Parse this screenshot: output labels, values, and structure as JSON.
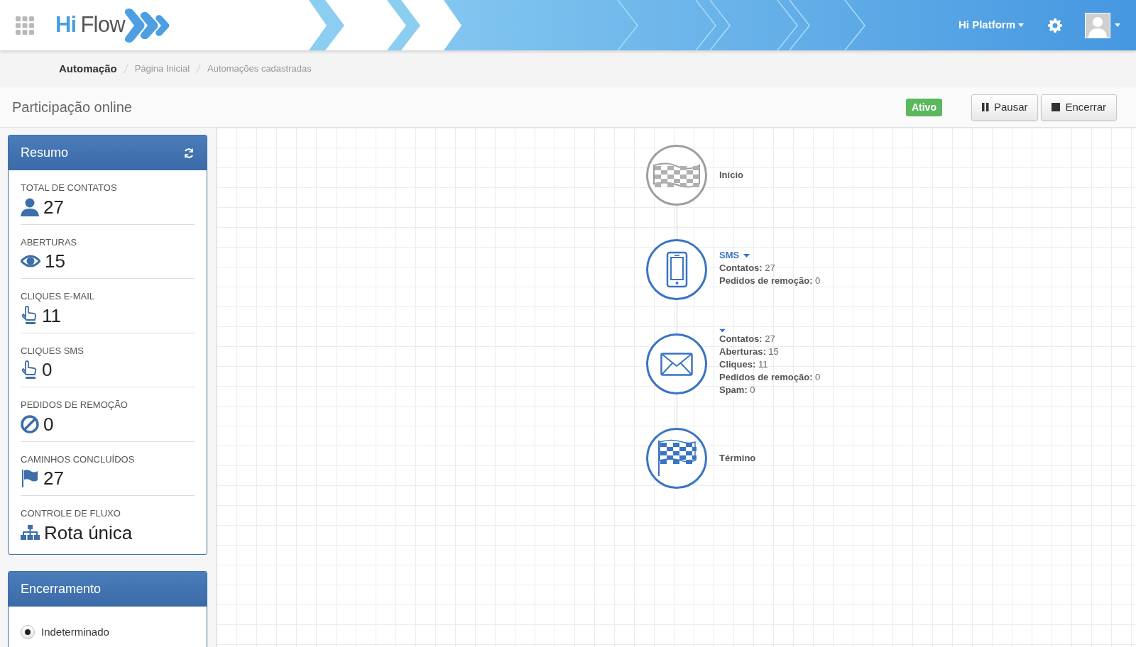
{
  "header": {
    "logo": {
      "first": "Hi",
      "second": "Flow"
    },
    "platform_menu": "Hi Platform"
  },
  "breadcrumb": [
    {
      "label": "Automação",
      "current": true
    },
    {
      "label": "Página Inicial",
      "current": false
    },
    {
      "label": "Automações cadastradas",
      "current": false
    }
  ],
  "page": {
    "title": "Participação online",
    "status": "Ativo",
    "buttons": [
      {
        "kind": "pause",
        "label": "Pausar"
      },
      {
        "kind": "stop",
        "label": "Encerrar"
      }
    ]
  },
  "summary": {
    "title": "Resumo",
    "metrics": [
      {
        "kind": "contacts",
        "label": "TOTAL DE CONTATOS",
        "value": "27"
      },
      {
        "kind": "opens",
        "label": "ABERTURAS",
        "value": "15"
      },
      {
        "kind": "clicks",
        "label": "CLIQUES E-MAIL",
        "value": "11"
      },
      {
        "kind": "clicks",
        "label": "CLIQUES SMS",
        "value": "0"
      },
      {
        "kind": "removals",
        "label": "PEDIDOS DE REMOÇÃO",
        "value": "0"
      },
      {
        "kind": "completed",
        "label": "CAMINHOS CONCLUÍDOS",
        "value": "27"
      },
      {
        "kind": "flow",
        "label": "CONTROLE DE FLUXO",
        "value": "Rota única"
      }
    ]
  },
  "closing": {
    "title": "Encerramento",
    "options": [
      {
        "label": "Indeterminado",
        "selected": true
      }
    ]
  },
  "flow": {
    "nodes": [
      {
        "kind": "start",
        "title": "Início",
        "menu": false
      },
      {
        "kind": "sms",
        "title": "SMS",
        "menu": true,
        "stats": [
          {
            "label": "Contatos:",
            "value": "27"
          },
          {
            "label": "Pedidos de remoção:",
            "value": "0"
          }
        ]
      },
      {
        "kind": "email",
        "menu": true,
        "stats": [
          {
            "label": "Contatos:",
            "value": "27"
          },
          {
            "label": "Aberturas:",
            "value": "15"
          },
          {
            "label": "Cliques:",
            "value": "11"
          },
          {
            "label": "Pedidos de remoção:",
            "value": "0"
          },
          {
            "label": "Spam:",
            "value": "0"
          }
        ]
      },
      {
        "kind": "end",
        "title": "Término",
        "menu": false
      }
    ]
  }
}
